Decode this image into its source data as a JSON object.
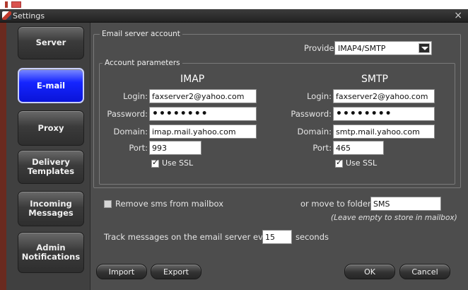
{
  "window": {
    "title": "Settings",
    "close_glyph": "×"
  },
  "sidebar": {
    "items": [
      {
        "label": "Server",
        "active": false
      },
      {
        "label": "E-mail",
        "active": true
      },
      {
        "label": "Proxy",
        "active": false
      },
      {
        "label": "Delivery\nTemplates",
        "active": false
      },
      {
        "label": "Incoming\nMessages",
        "active": false
      },
      {
        "label": "Admin\nNotifications",
        "active": false
      }
    ]
  },
  "email_server_account": {
    "legend": "Email server account",
    "provider_label": "Provider:",
    "provider_value": "IMAP4/SMTP"
  },
  "account_parameters": {
    "legend": "Account parameters",
    "imap": {
      "header": "IMAP",
      "login_label": "Login:",
      "login_value": "faxserver2@yahoo.com",
      "password_label": "Password:",
      "password_value": "••••••••",
      "domain_label": "Domain:",
      "domain_value": "imap.mail.yahoo.com",
      "port_label": "Port:",
      "port_value": "993",
      "ssl_label": "Use SSL",
      "ssl_checked": true
    },
    "smtp": {
      "header": "SMTP",
      "login_label": "Login:",
      "login_value": "faxserver2@yahoo.com",
      "password_label": "Password:",
      "password_value": "••••••••",
      "domain_label": "Domain:",
      "domain_value": "smtp.mail.yahoo.com",
      "port_label": "Port:",
      "port_value": "465",
      "ssl_label": "Use SSL",
      "ssl_checked": true
    }
  },
  "options": {
    "remove_sms_label": "Remove sms from mailbox",
    "remove_sms_checked": false,
    "move_folder_label": "or move to folder:",
    "move_folder_value": "SMS",
    "move_folder_hint": "(Leave empty to store in mailbox)",
    "track_prefix": "Track messages on the email server every",
    "track_value": "15",
    "track_suffix": "seconds"
  },
  "buttons": {
    "import": "Import",
    "export": "Export",
    "ok": "OK",
    "cancel": "Cancel"
  }
}
